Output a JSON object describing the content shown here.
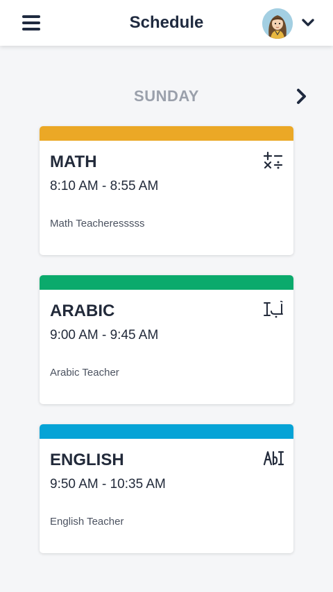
{
  "header": {
    "title": "Schedule",
    "menu_icon": "hamburger-menu-icon",
    "avatar_icon": "user-avatar",
    "account_icon": "chevron-down-icon"
  },
  "day": {
    "label": "SUNDAY",
    "next_icon": "chevron-right-icon"
  },
  "classes": [
    {
      "subject": "MATH",
      "time": "8:10 AM - 8:55 AM",
      "teacher": "Math Teacheresssss",
      "color": "#EBA826",
      "icon": "math-operators-icon"
    },
    {
      "subject": "ARABIC",
      "time": "9:00 AM - 9:45 AM",
      "teacher": "Arabic Teacher",
      "color": "#0BAA6C",
      "icon": "arabic-text-icon"
    },
    {
      "subject": "ENGLISH",
      "time": "9:50 AM - 10:35 AM",
      "teacher": "English Teacher",
      "color": "#06A3D6",
      "icon": "english-text-icon"
    }
  ]
}
